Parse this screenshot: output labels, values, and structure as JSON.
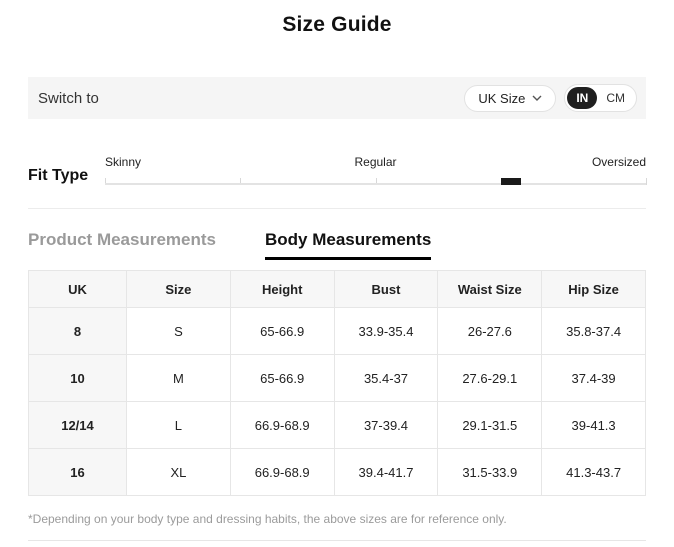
{
  "page": {
    "title": "Size Guide"
  },
  "switch_bar": {
    "label": "Switch to",
    "size_dropdown": {
      "value": "UK Size"
    },
    "unit_toggle": {
      "options": [
        "IN",
        "CM"
      ],
      "selected": "IN"
    }
  },
  "fit_type": {
    "label": "Fit Type",
    "options": [
      "Skinny",
      "Regular",
      "Oversized"
    ],
    "handle_position_percent": 75,
    "tick_positions_percent": [
      0,
      25,
      50,
      75,
      100
    ]
  },
  "tabs": [
    {
      "label": "Product Measurements",
      "active": false
    },
    {
      "label": "Body Measurements",
      "active": true
    }
  ],
  "table": {
    "columns": [
      "UK",
      "Size",
      "Height",
      "Bust",
      "Waist Size",
      "Hip Size"
    ],
    "rows": [
      [
        "8",
        "S",
        "65-66.9",
        "33.9-35.4",
        "26-27.6",
        "35.8-37.4"
      ],
      [
        "10",
        "M",
        "65-66.9",
        "35.4-37",
        "27.6-29.1",
        "37.4-39"
      ],
      [
        "12/14",
        "L",
        "66.9-68.9",
        "37-39.4",
        "29.1-31.5",
        "39-41.3"
      ],
      [
        "16",
        "XL",
        "66.9-68.9",
        "39.4-41.7",
        "31.5-33.9",
        "41.3-43.7"
      ]
    ]
  },
  "footnote": "*Depending on your body type and dressing habits, the above sizes are for reference only.",
  "colors": {
    "accent_dark": "#1f1f1f",
    "bar_bg": "#f5f5f5",
    "table_header_bg": "#f7f7f7",
    "border": "#e6e6e6",
    "muted_text": "#9b9b9b"
  }
}
